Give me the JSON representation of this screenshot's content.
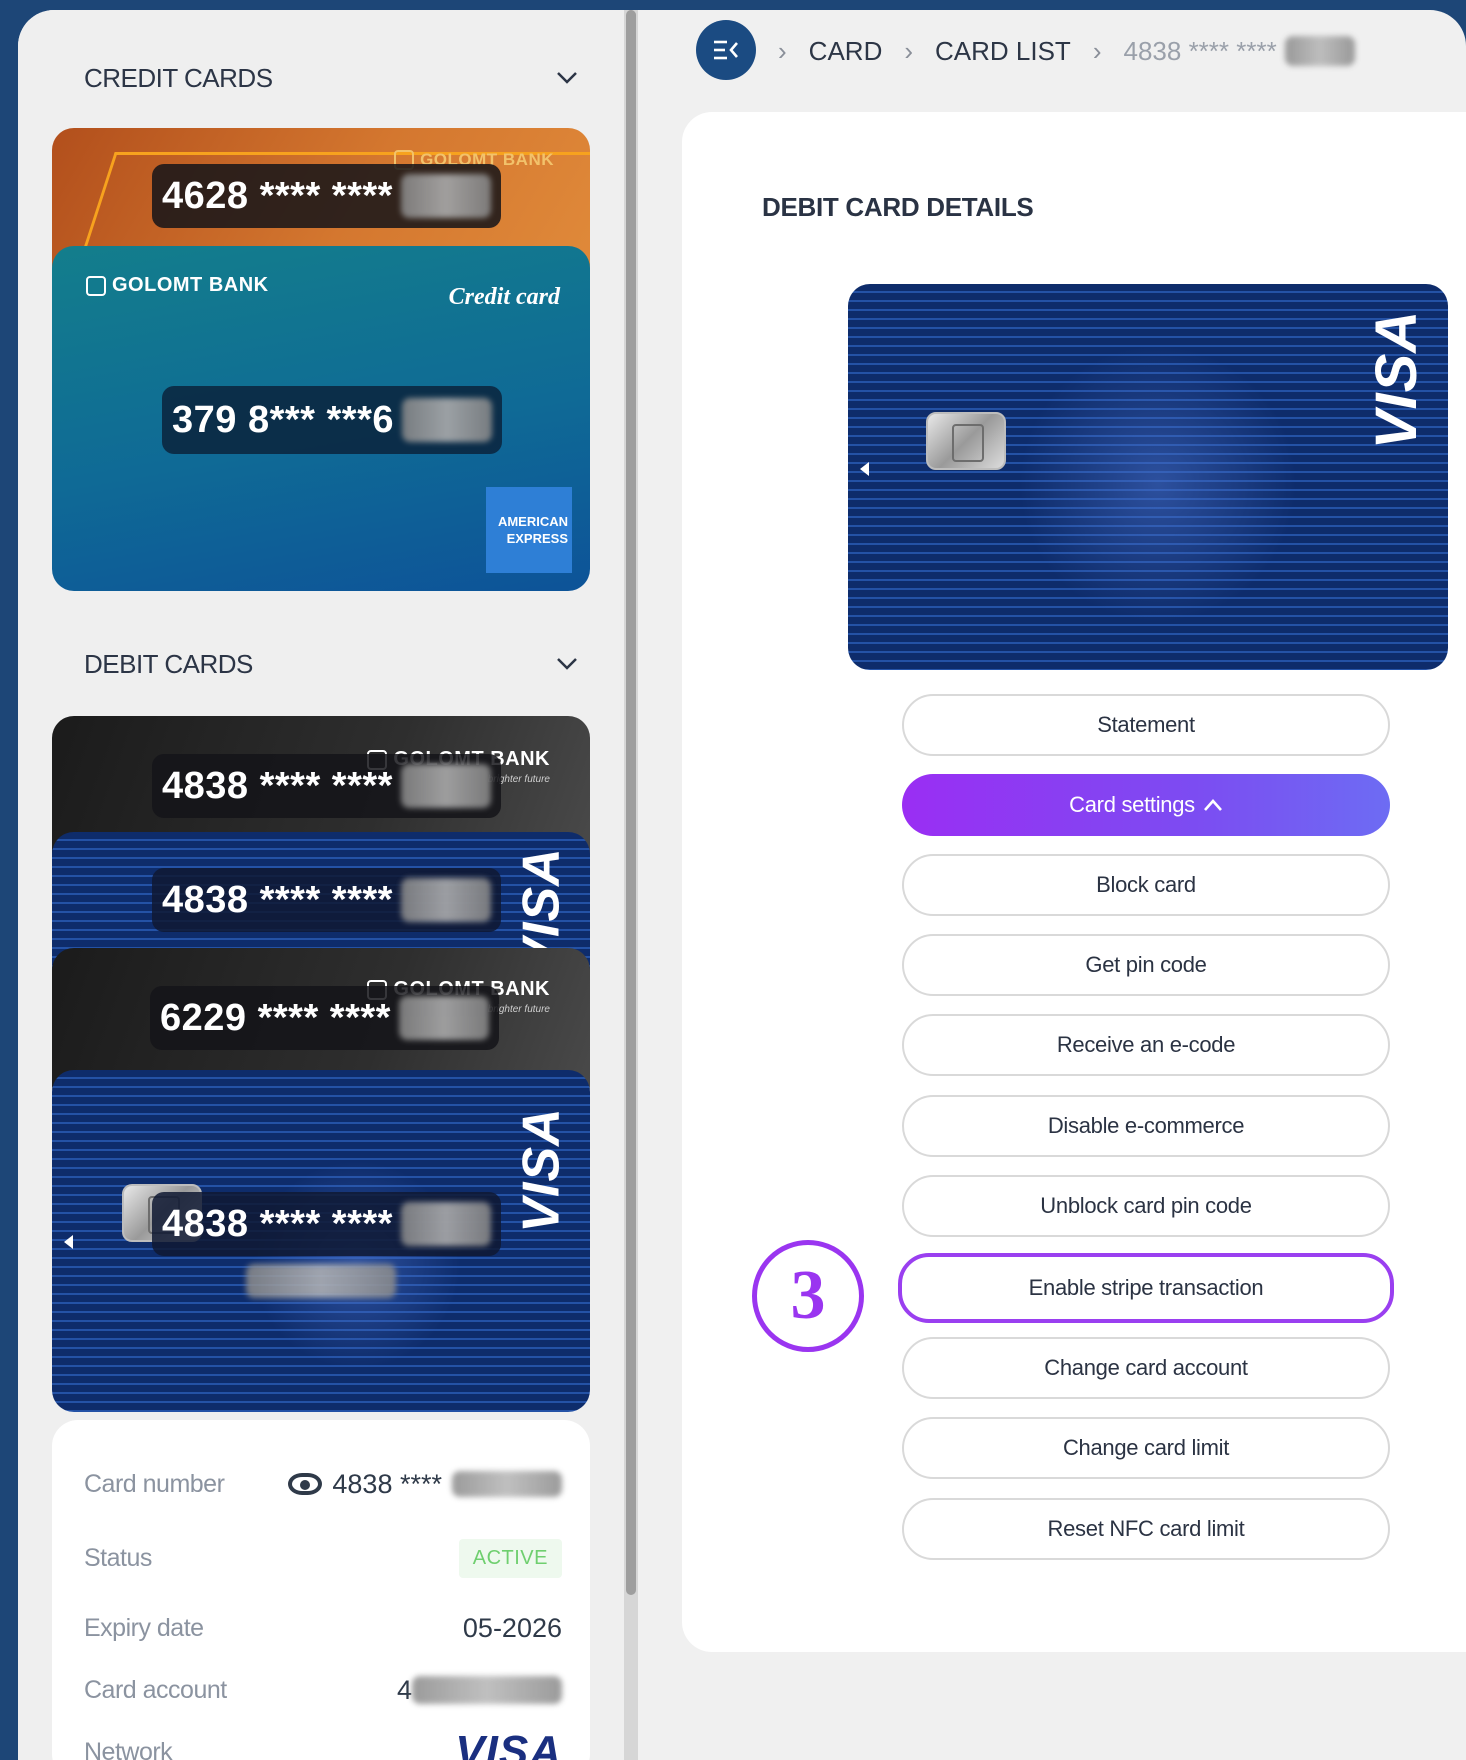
{
  "sidebar": {
    "credit_section_title": "CREDIT CARDS",
    "debit_section_title": "DEBIT CARDS",
    "credit_cards": [
      {
        "number_prefix": "4628 **** ****",
        "brand": "GOLOMT BANK"
      },
      {
        "number_prefix": "379 8*** ***6",
        "brand": "GOLOMT BANK",
        "label": "Credit card",
        "network_line1": "AMERICAN",
        "network_line2": "EXPRESS"
      }
    ],
    "debit_cards": [
      {
        "number_prefix": "4838 **** ****",
        "brand": "GOLOMT BANK",
        "tagline": "brighter future"
      },
      {
        "number_prefix": "4838 **** ****",
        "network": "VISA"
      },
      {
        "number_prefix": "6229 **** ****",
        "brand": "GOLOMT BANK",
        "tagline": "brighter future"
      },
      {
        "number_prefix": "4838 **** ****",
        "network": "VISA"
      }
    ],
    "info": {
      "card_number_label": "Card number",
      "card_number_value": "4838 ****",
      "status_label": "Status",
      "status_value": "ACTIVE",
      "expiry_label": "Expiry date",
      "expiry_value": "05-2026",
      "account_label": "Card account",
      "account_value_prefix": "4",
      "network_label": "Network",
      "network_value": "VISA"
    }
  },
  "header": {
    "breadcrumb": [
      "CARD",
      "CARD LIST",
      "4838 **** ****"
    ]
  },
  "main": {
    "title": "DEBIT CARD DETAILS",
    "card_network": "VISA",
    "actions": [
      "Statement",
      "Card settings",
      "Block card",
      "Get pin code",
      "Receive an e-code",
      "Disable e-commerce",
      "Unblock card pin code",
      "Enable stripe transaction",
      "Change card account",
      "Change card limit",
      "Reset NFC card limit"
    ],
    "highlight_marker": "3"
  },
  "colors": {
    "background": "#1d4677",
    "accent_purple": "#9a35f0",
    "status_green": "#6fcf6f",
    "visa_navy": "#1a2f80"
  },
  "icons": {
    "menu": "menu-collapse-icon",
    "chevron": "chevron-down-icon",
    "eye": "eye-icon",
    "settings_chevron": "chevron-up-icon"
  }
}
